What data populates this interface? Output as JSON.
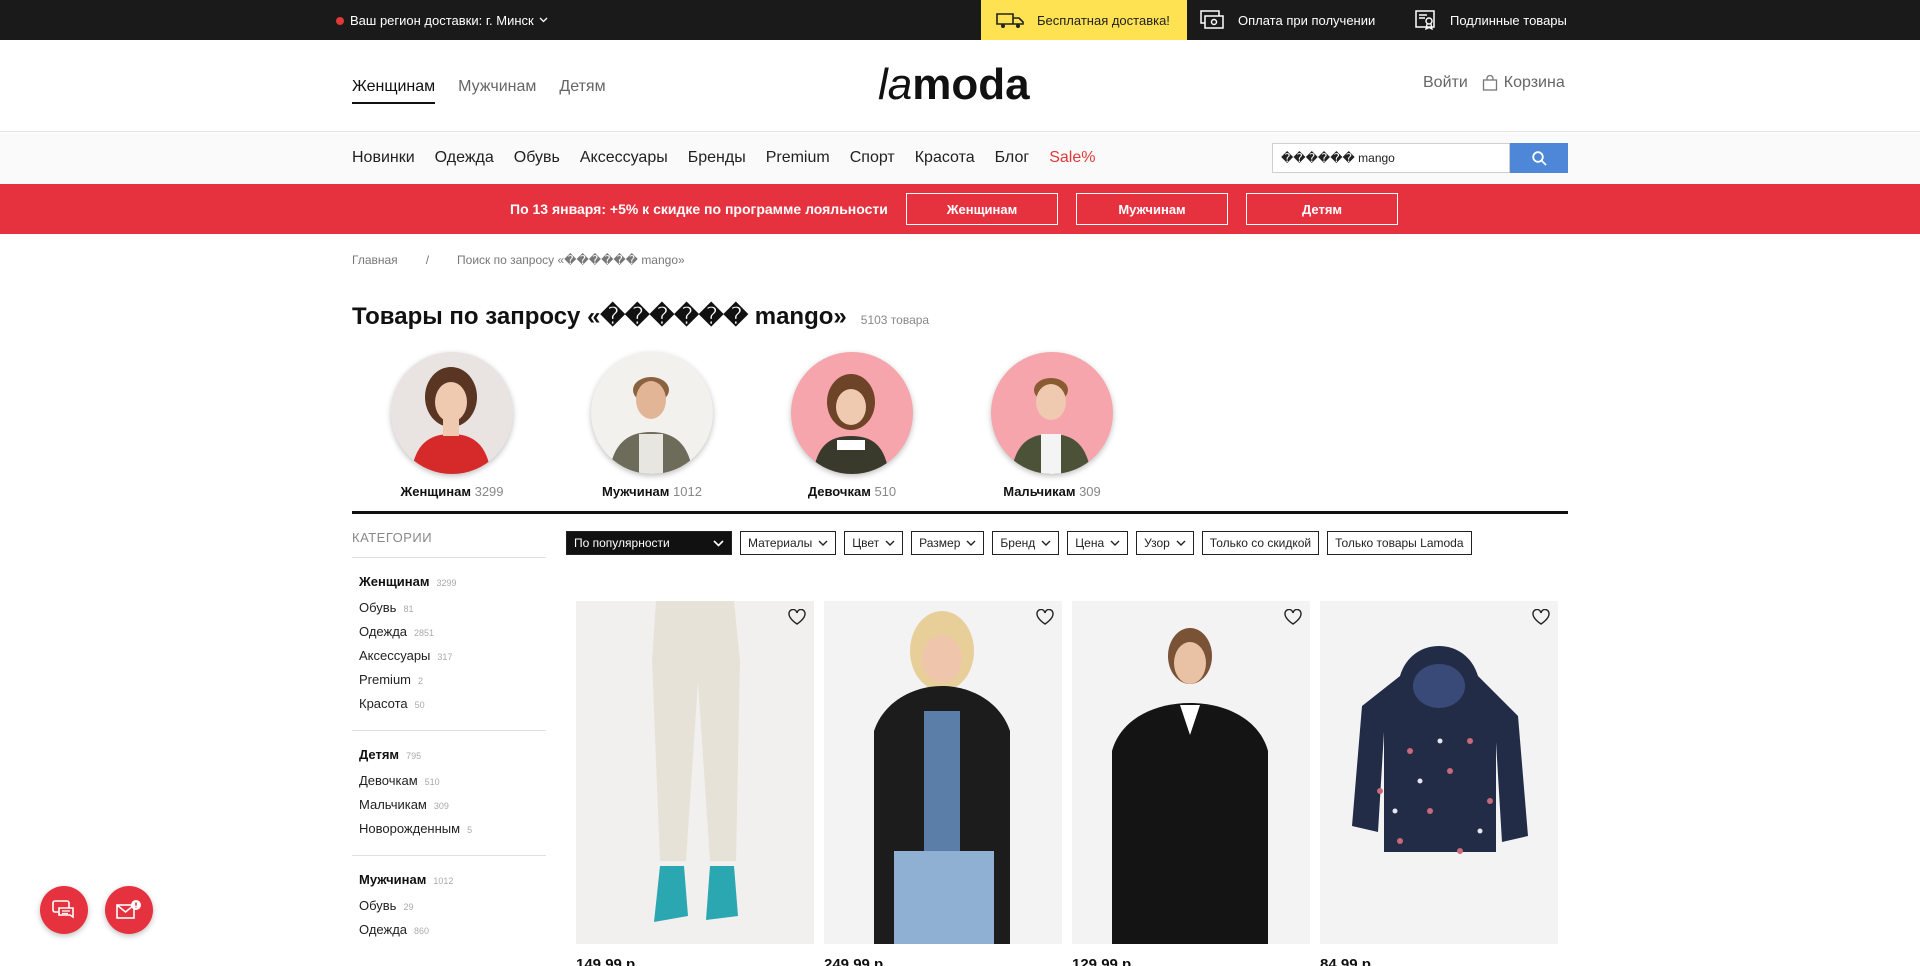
{
  "topbar": {
    "region_label": "Ваш регион доставки:",
    "region_value": "г. Минск",
    "free_delivery": "Бесплатная доставка!",
    "cash_on_delivery": "Оплата при получении",
    "authentic": "Подлинные товары"
  },
  "header": {
    "tabs": [
      "Женщинам",
      "Мужчинам",
      "Детям"
    ],
    "logo_la": "la",
    "logo_moda": "moda",
    "login": "Войти",
    "cart": "Корзина"
  },
  "menu": {
    "items": [
      "Новинки",
      "Одежда",
      "Обувь",
      "Аксессуары",
      "Бренды",
      "Premium",
      "Спорт",
      "Красота",
      "Блог"
    ],
    "sale": "Sale%",
    "search_value": "������ mango"
  },
  "promo": {
    "text": "По 13 января: +5% к скидке по программе лояльности",
    "buttons": [
      "Женщинам",
      "Мужчинам",
      "Детям"
    ]
  },
  "breadcrumb": {
    "home": "Главная",
    "sep": "/",
    "current": "Поиск по запросу «������ mango»"
  },
  "title": {
    "text": "Товары по запросу «������ mango»",
    "count": "5103 товара"
  },
  "circles": [
    {
      "label": "Женщинам",
      "count": "3299"
    },
    {
      "label": "Мужчинам",
      "count": "1012"
    },
    {
      "label": "Девочкам",
      "count": "510"
    },
    {
      "label": "Мальчикам",
      "count": "309"
    }
  ],
  "sidebar": {
    "title": "КАТЕГОРИИ",
    "groups": [
      {
        "name": "Женщинам",
        "count": "3299",
        "items": [
          {
            "name": "Обувь",
            "count": "81"
          },
          {
            "name": "Одежда",
            "count": "2851"
          },
          {
            "name": "Аксессуары",
            "count": "317"
          },
          {
            "name": "Premium",
            "count": "2"
          },
          {
            "name": "Красота",
            "count": "50"
          }
        ]
      },
      {
        "name": "Детям",
        "count": "795",
        "items": [
          {
            "name": "Девочкам",
            "count": "510"
          },
          {
            "name": "Мальчикам",
            "count": "309"
          },
          {
            "name": "Новорожденным",
            "count": "5"
          }
        ]
      },
      {
        "name": "Мужчинам",
        "count": "1012",
        "items": [
          {
            "name": "Обувь",
            "count": "29"
          },
          {
            "name": "Одежда",
            "count": "860"
          }
        ]
      }
    ]
  },
  "filters": {
    "sort": "По популярности",
    "items": [
      "Материалы",
      "Цвет",
      "Размер",
      "Бренд",
      "Цена",
      "Узор"
    ],
    "toggles": [
      "Только со скидкой",
      "Только товары Lamoda"
    ]
  },
  "products": [
    {
      "price": "149.99 р.",
      "image": "cream-trousers-teal-boots"
    },
    {
      "price": "249.99 р.",
      "image": "black-leather-jacket"
    },
    {
      "price": "129.99 р.",
      "image": "black-blazer"
    },
    {
      "price": "84.99 р.",
      "image": "floral-navy-puffer-jacket"
    }
  ],
  "colors": {
    "accent_red": "#e6313f",
    "yellow": "#ffe252",
    "search_blue": "#4e86d8",
    "topbar": "#1a1a1a"
  }
}
